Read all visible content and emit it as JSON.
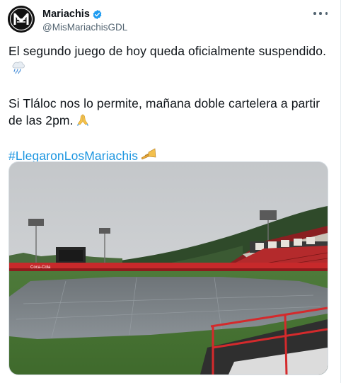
{
  "tweet": {
    "display_name": "Mariachis",
    "handle": "@MisMariachisGDL",
    "paragraphs": [
      "El segundo juego de hoy queda oficialmente suspendido.",
      "Si Tláloc nos lo permite, mañana doble cartelera a partir de las 2pm."
    ],
    "hashtag": "#LlegaronLosMariachis",
    "emojis": [
      "cloud-rain-icon",
      "praying-hands-icon",
      "trumpet-icon"
    ],
    "verified": true
  },
  "media": {
    "banner_text": "Coca-Cola"
  },
  "colors": {
    "link": "#1b95e0",
    "verified": "#1d9bf0",
    "text": "#0f1419",
    "muted": "#536471"
  }
}
